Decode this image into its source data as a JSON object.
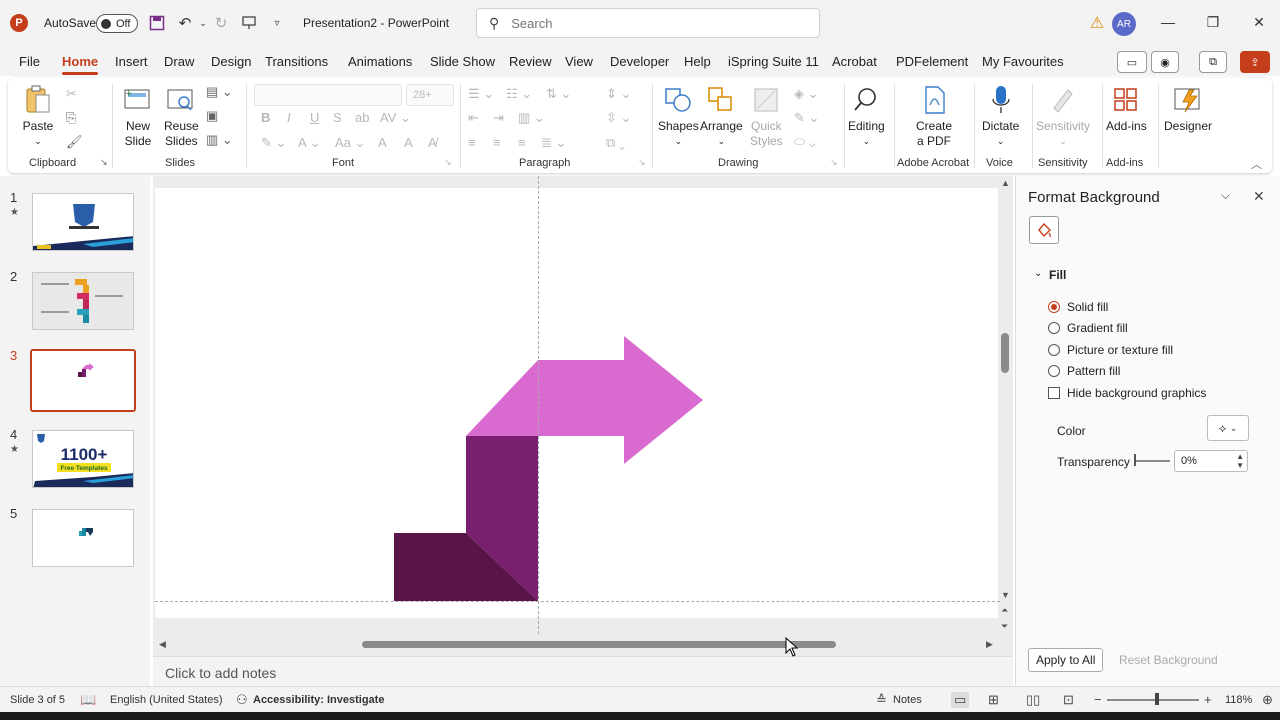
{
  "titlebar": {
    "autosave_label": "AutoSave",
    "autosave_state": "Off",
    "doc_title": "Presentation2  -  PowerPoint",
    "search_placeholder": "Search",
    "avatar_initials": "AR"
  },
  "menu": {
    "tabs": [
      "File",
      "Home",
      "Insert",
      "Draw",
      "Design",
      "Transitions",
      "Animations",
      "Slide Show",
      "Review",
      "View",
      "Developer",
      "Help",
      "iSpring Suite 11",
      "Acrobat",
      "PDFelement",
      "My Favourites"
    ],
    "active_tab": "Home"
  },
  "ribbon": {
    "paste": "Paste",
    "new_slide": "New\nSlide",
    "reuse_slides": "Reuse\nSlides",
    "font_size": "28+",
    "shapes": "Shapes",
    "arrange": "Arrange",
    "quick_styles": "Quick\nStyles",
    "editing": "Editing",
    "create_pdf": "Create\na PDF",
    "dictate": "Dictate",
    "sensitivity": "Sensitivity",
    "add_ins": "Add-ins",
    "designer": "Designer",
    "groups": {
      "clipboard": "Clipboard",
      "slides": "Slides",
      "font": "Font",
      "paragraph": "Paragraph",
      "drawing": "Drawing",
      "adobe_acrobat": "Adobe Acrobat",
      "voice": "Voice",
      "sensitivity": "Sensitivity",
      "add_ins": "Add-ins"
    }
  },
  "thumbnails": {
    "numbers": [
      "1",
      "2",
      "3",
      "4",
      "5"
    ],
    "active_index": 3,
    "slide4_text": "1100+",
    "slide4_subtext": "Free Templates"
  },
  "slide": {
    "arrow_color": "#d86ad0",
    "upper_riser_color": "#7a1f6e",
    "lower_block_color": "#5a1548"
  },
  "notes": {
    "placeholder": "Click to add notes"
  },
  "format_pane": {
    "title": "Format Background",
    "section": "Fill",
    "options": [
      "Solid fill",
      "Gradient fill",
      "Picture or texture fill",
      "Pattern fill"
    ],
    "selected_option": "Solid fill",
    "hide_graphics": "Hide background graphics",
    "color_label": "Color",
    "transparency_label": "Transparency",
    "transparency_value": "0%",
    "apply_all": "Apply to All",
    "reset": "Reset Background"
  },
  "status": {
    "slide_info": "Slide 3 of 5",
    "language": "English (United States)",
    "accessibility": "Accessibility: Investigate",
    "notes": "Notes",
    "zoom": "118%"
  },
  "colors": {
    "accent": "#c43e1c"
  }
}
